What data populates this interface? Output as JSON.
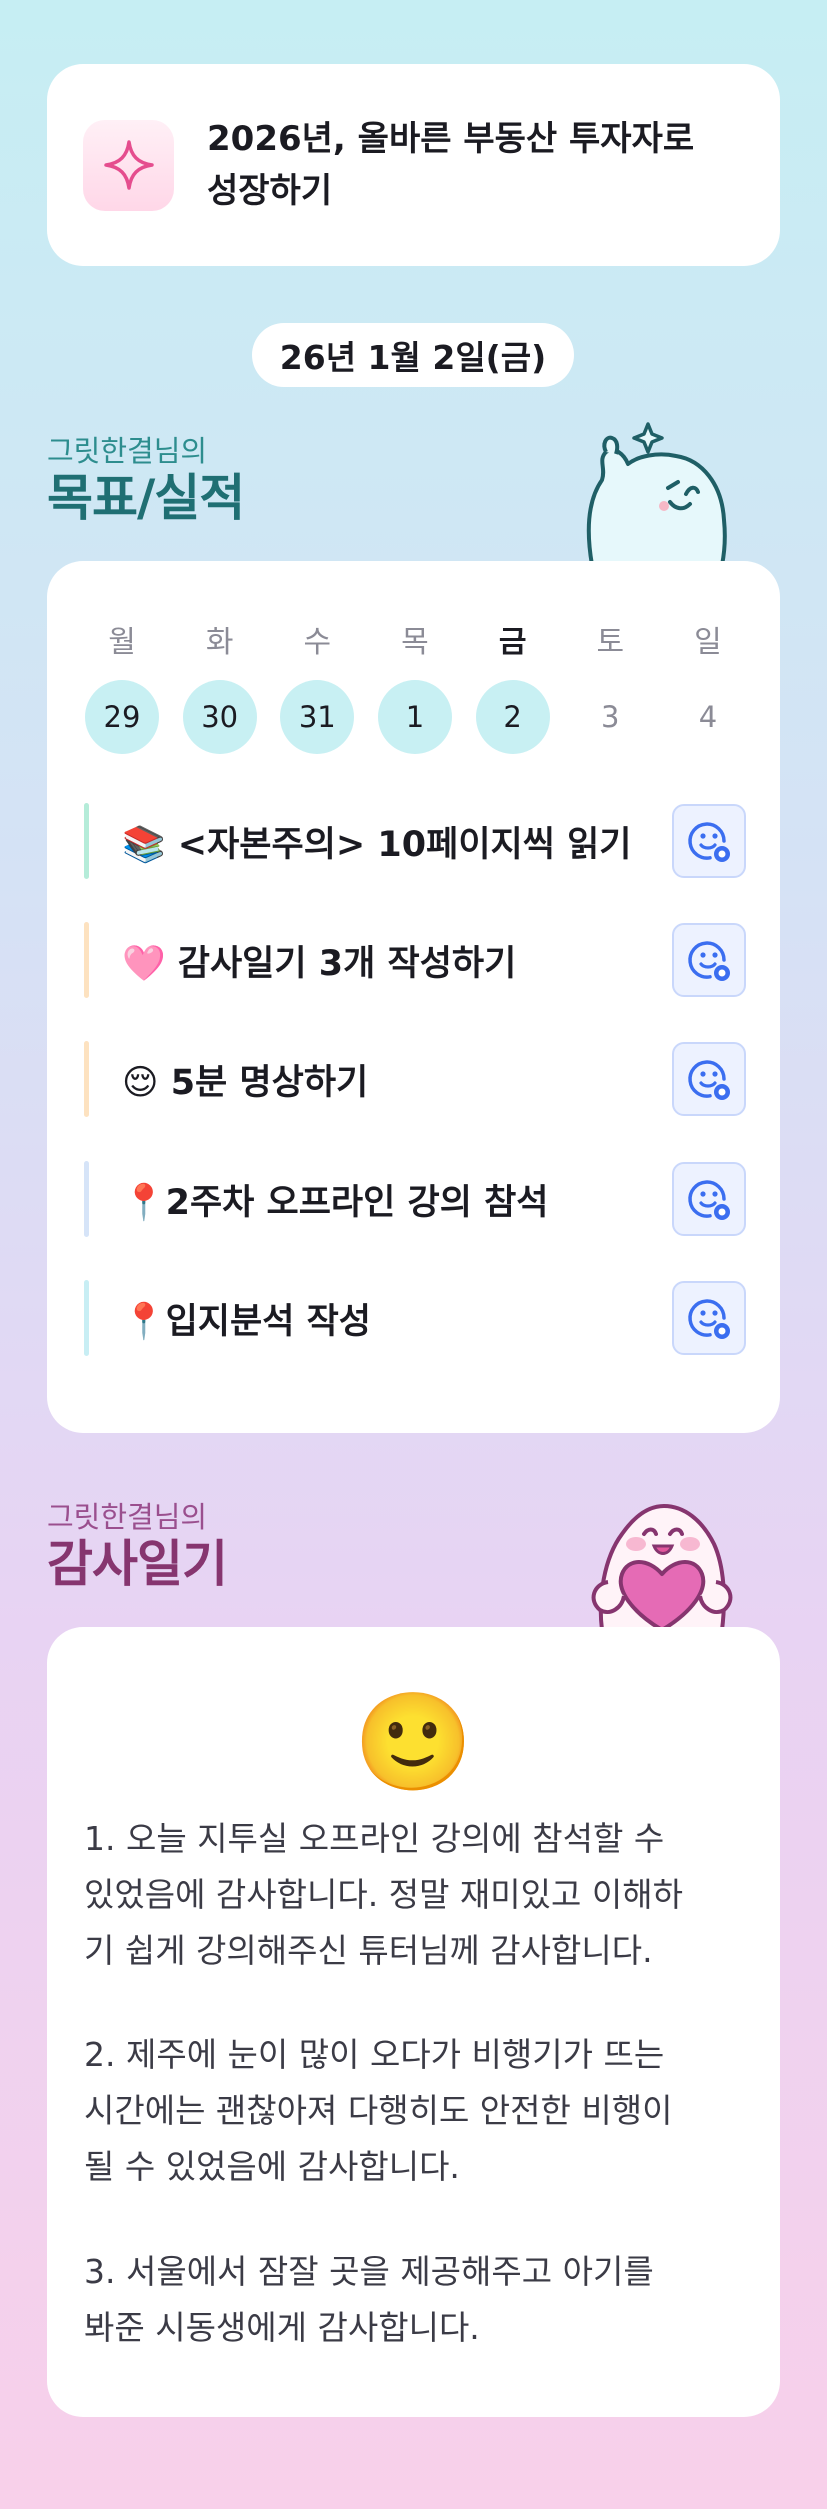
{
  "goal": {
    "title": "2026년, 올바른 부동산 투자자로 성장하기",
    "icon": "sparkle-icon",
    "accent": "#e54d8e"
  },
  "date": "26년 1월 2일(금)",
  "goals_section": {
    "subtitle": "그릿한결님의",
    "title": "목표/실적"
  },
  "calendar": {
    "weekdays": [
      "월",
      "화",
      "수",
      "목",
      "금",
      "토",
      "일"
    ],
    "days": [
      "29",
      "30",
      "31",
      "1",
      "2",
      "3",
      "4"
    ],
    "completed_days": 5,
    "today_index": 4
  },
  "tasks": [
    {
      "emoji": "📚",
      "text": "<자본주의> 10페이지씩 읽기",
      "color": "#b5ecd9",
      "reaction_icon": "add-reaction-icon"
    },
    {
      "emoji": "🩷",
      "text": "감사일기 3개 작성하기",
      "color": "#fde2c0",
      "reaction_icon": "add-reaction-icon"
    },
    {
      "emoji": "😌",
      "text": "5분 명상하기",
      "color": "#fde2c0",
      "reaction_icon": "add-reaction-icon"
    },
    {
      "emoji": "📍",
      "text": "2주차 오프라인 강의 참석",
      "color": "#d6e4f8",
      "reaction_icon": "add-reaction-icon"
    },
    {
      "emoji": "📍",
      "text": "입지분석 작성",
      "color": "#c8eef4",
      "reaction_icon": "add-reaction-icon"
    }
  ],
  "thanks_section": {
    "subtitle": "그릿한결님의",
    "title": "감사일기"
  },
  "journal": {
    "mood_emoji": "🙂",
    "entries": [
      [
        "1. 오늘 지투실 오프라인 강의에 참석할 수",
        "있었음에 감사합니다. 정말 재미있고 이해하",
        "기 쉽게 강의해주신 튜터님께 감사합니다."
      ],
      [
        "2. 제주에 눈이 많이 오다가 비행기가 뜨는",
        "시간에는 괜찮아져 다행히도 안전한 비행이",
        "될 수 있었음에 감사합니다."
      ],
      [
        "3. 서울에서 잠잘 곳을 제공해주고 아기를",
        "봐준 시동생에게 감사합니다."
      ]
    ]
  }
}
